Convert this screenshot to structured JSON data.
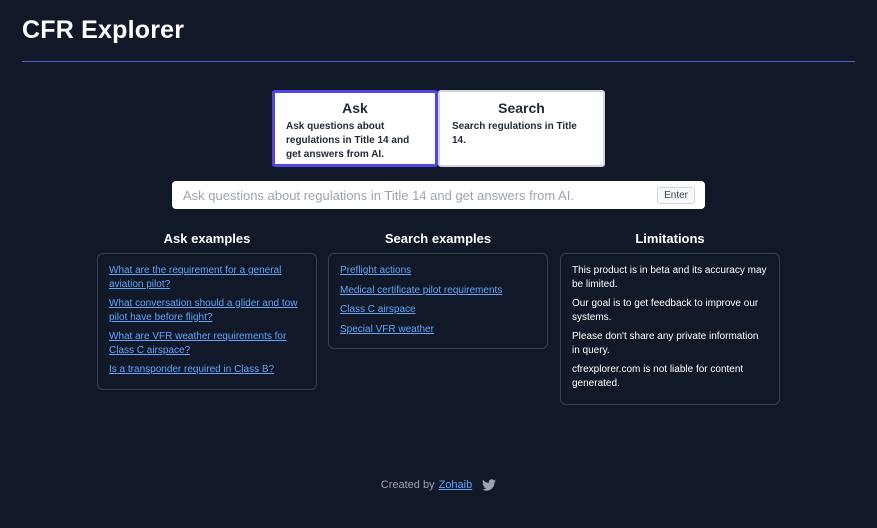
{
  "app": {
    "title": "CFR Explorer"
  },
  "modes": [
    {
      "title": "Ask",
      "description": "Ask questions about regulations in Title 14 and get answers from AI.",
      "active": true
    },
    {
      "title": "Search",
      "description": "Search regulations in Title 14.",
      "active": false
    }
  ],
  "query": {
    "value": "",
    "placeholder": "Ask questions about regulations in Title 14 and get answers from AI.",
    "enter_label": "Enter"
  },
  "ask_examples": {
    "heading": "Ask examples",
    "items": [
      "What are the requirement for a general aviation pilot?",
      "What conversation should a glider and tow pilot have before flight?",
      "What are VFR weather requirements for Class C airspace?",
      "Is a transponder required in Class B?"
    ]
  },
  "search_examples": {
    "heading": "Search examples",
    "items": [
      "Preflight actions",
      "Medical certificate pilot requirements",
      "Class C airspace",
      "Special VFR weather"
    ]
  },
  "limitations": {
    "heading": "Limitations",
    "items": [
      "This product is in beta and its accuracy may be limited.",
      "Our goal is to get feedback to improve our systems.",
      "Please don't share any private information in query.",
      "cfrexplorer.com is not liable for content generated."
    ]
  },
  "footer": {
    "created_by": "Created by",
    "author": "Zohaib",
    "icon": "twitter-icon"
  },
  "colors": {
    "background": "#111827",
    "accent": "#4f46e5",
    "link": "#60a5fa",
    "divider": "#4f5bd5"
  }
}
